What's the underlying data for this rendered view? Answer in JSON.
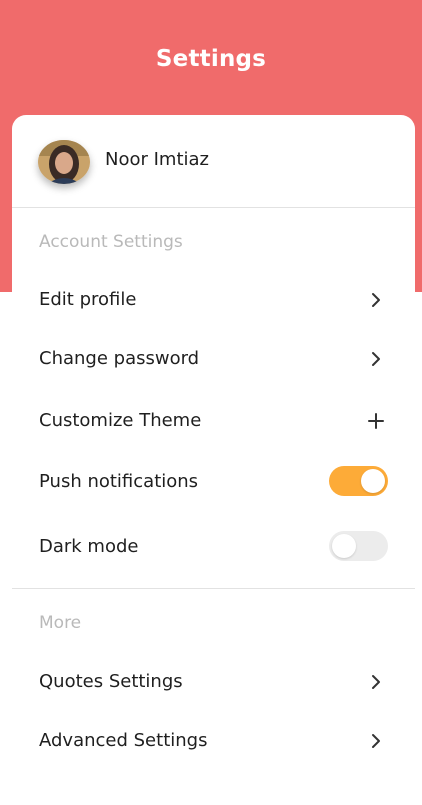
{
  "header": {
    "title": "Settings"
  },
  "profile": {
    "name": "Noor Imtiaz"
  },
  "account_section": {
    "title": "Account Settings",
    "items": [
      {
        "label": "Edit profile",
        "control": "chevron"
      },
      {
        "label": "Change password",
        "control": "chevron"
      },
      {
        "label": "Customize Theme",
        "control": "plus"
      },
      {
        "label": "Push notifications",
        "control": "toggle",
        "enabled": true
      },
      {
        "label": "Dark mode",
        "control": "toggle",
        "enabled": false
      }
    ]
  },
  "more_section": {
    "title": "More",
    "items": [
      {
        "label": "Quotes Settings",
        "control": "chevron"
      },
      {
        "label": "Advanced Settings",
        "control": "chevron"
      }
    ]
  },
  "colors": {
    "header_background": "#f06b6b",
    "toggle_on": "#fdab38",
    "toggle_off": "#ececec"
  }
}
